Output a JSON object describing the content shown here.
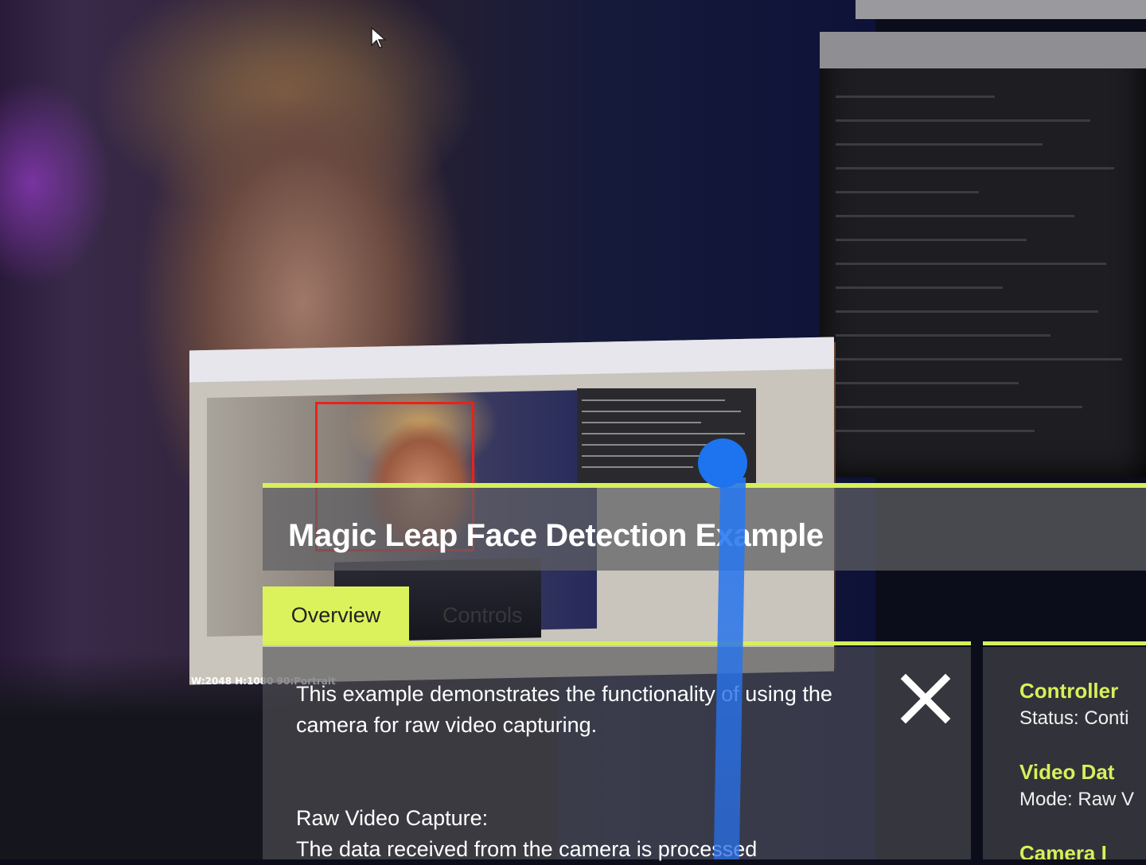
{
  "panel": {
    "title": "Magic Leap Face Detection Example",
    "tabs": [
      {
        "label": "Overview",
        "active": true
      },
      {
        "label": "Controls",
        "active": false
      }
    ],
    "overview_text": "This example demonstrates the functionality of using the camera for raw video capturing.",
    "section_heading": "Raw Video Capture:",
    "section_text": "The data received from the camera is processed",
    "close_icon": "close-icon"
  },
  "side_panel": {
    "sections": [
      {
        "heading": "Controller",
        "status": "Status: Conti"
      },
      {
        "heading": "Video Dat",
        "status": "Mode: Raw V"
      },
      {
        "heading": "Camera I",
        "status": ""
      }
    ]
  },
  "capture": {
    "resolution_label": "W:2048  H:1080  90:Portrait"
  },
  "colors": {
    "accent": "#d6f05a",
    "pointer": "#1e74ee",
    "face_box": "#e8221c"
  }
}
